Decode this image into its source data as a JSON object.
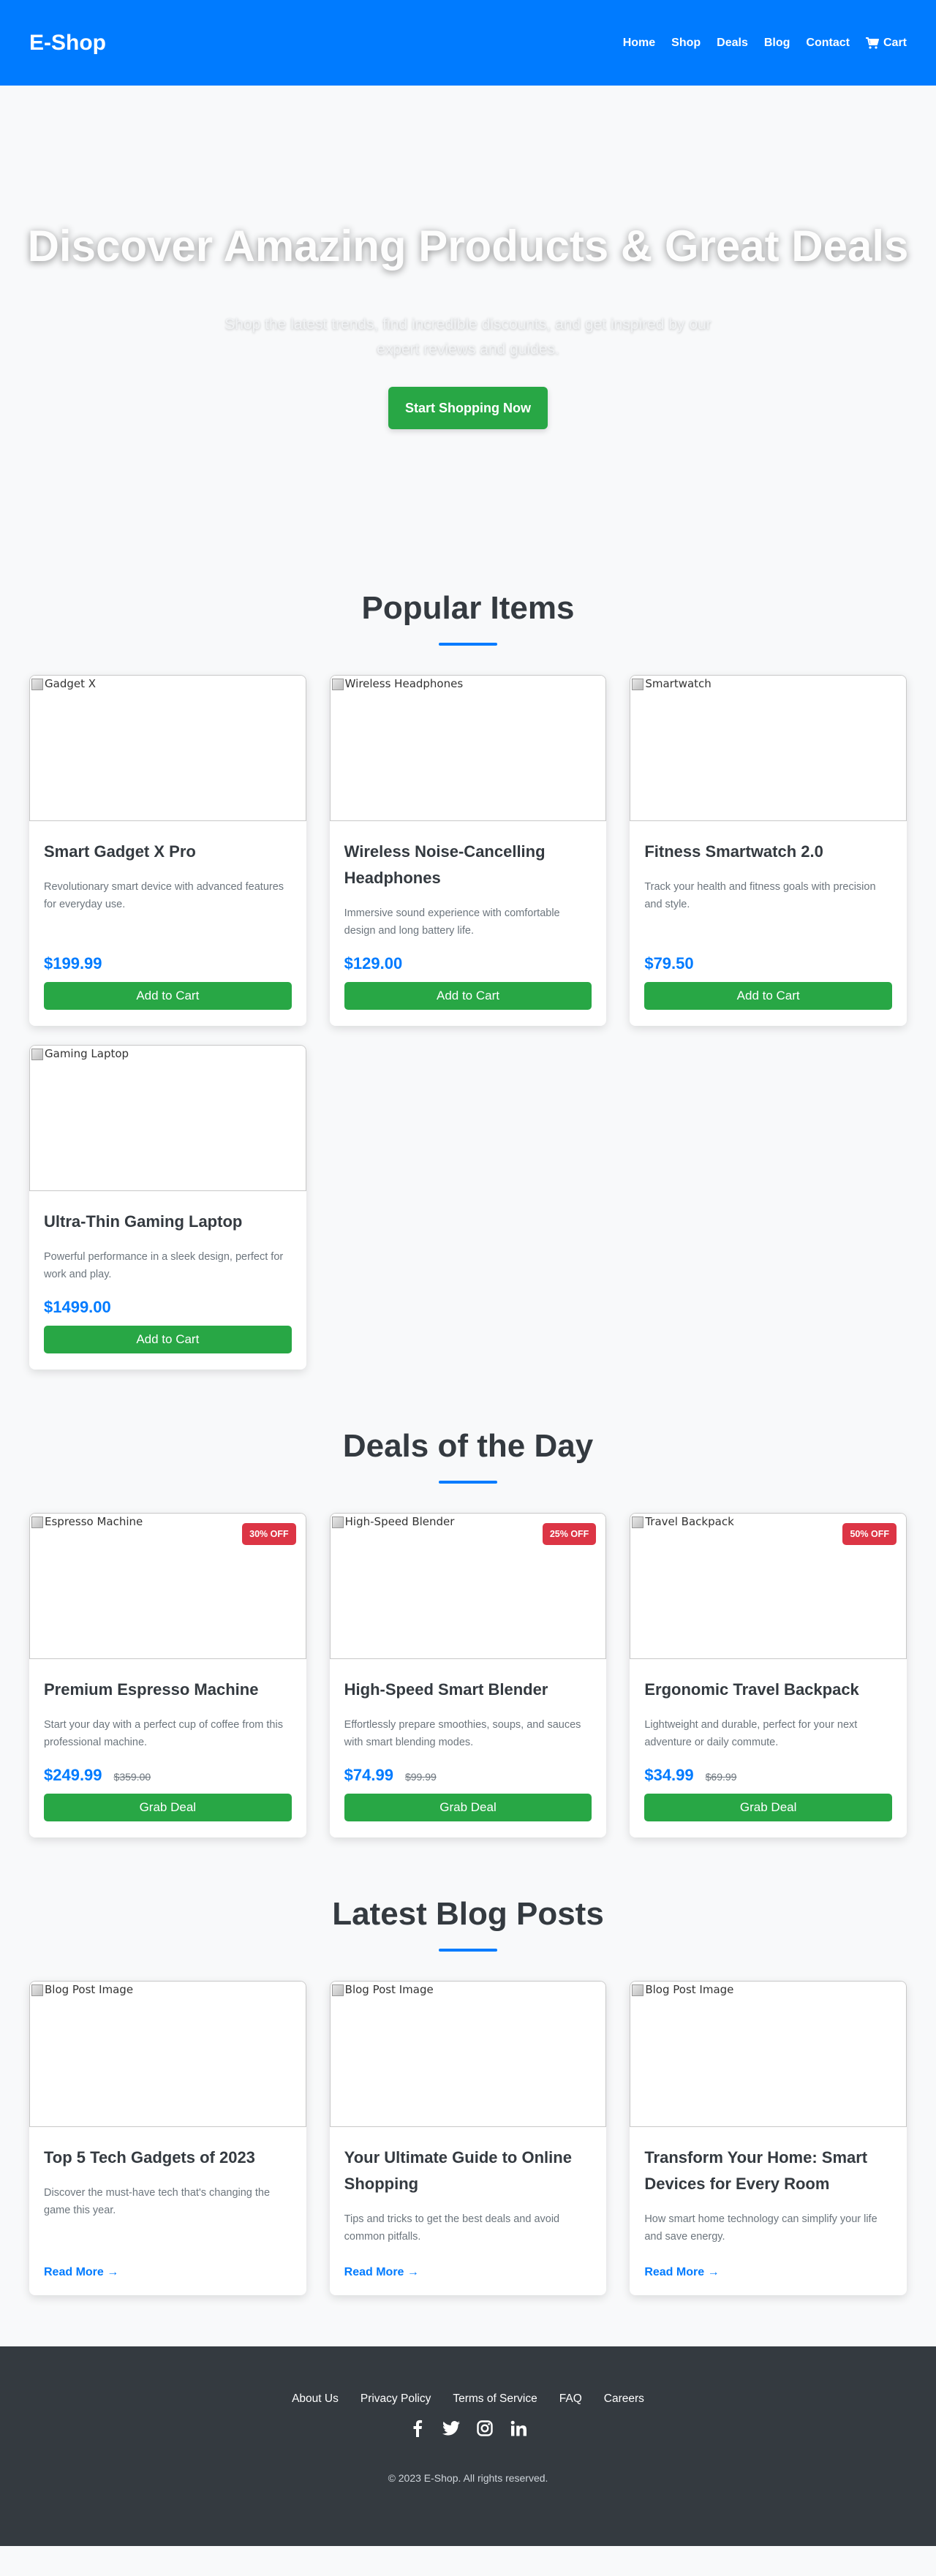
{
  "header": {
    "logo": "E-Shop",
    "nav": [
      "Home",
      "Shop",
      "Deals",
      "Blog",
      "Contact"
    ],
    "cart_label": "Cart"
  },
  "hero": {
    "title": "Discover Amazing Products & Great Deals",
    "subtitle": "Shop the latest trends, find incredible discounts, and get inspired by our expert reviews and guides.",
    "cta": "Start Shopping Now"
  },
  "popular": {
    "title": "Popular Items",
    "button_label": "Add to Cart",
    "items": [
      {
        "img_alt": "Gadget X",
        "title": "Smart Gadget X Pro",
        "desc": "Revolutionary smart device with advanced features for everyday use.",
        "price": "$199.99"
      },
      {
        "img_alt": "Wireless Headphones",
        "title": "Wireless Noise-Cancelling Headphones",
        "desc": "Immersive sound experience with comfortable design and long battery life.",
        "price": "$129.00"
      },
      {
        "img_alt": "Smartwatch",
        "title": "Fitness Smartwatch 2.0",
        "desc": "Track your health and fitness goals with precision and style.",
        "price": "$79.50"
      },
      {
        "img_alt": "Gaming Laptop",
        "title": "Ultra-Thin Gaming Laptop",
        "desc": "Powerful performance in a sleek design, perfect for work and play.",
        "price": "$1499.00"
      }
    ]
  },
  "deals": {
    "title": "Deals of the Day",
    "button_label": "Grab Deal",
    "items": [
      {
        "img_alt": "Espresso Machine",
        "badge": "30% OFF",
        "title": "Premium Espresso Machine",
        "desc": "Start your day with a perfect cup of coffee from this professional machine.",
        "price": "$249.99",
        "old_price": "$359.00"
      },
      {
        "img_alt": "High-Speed Blender",
        "badge": "25% OFF",
        "title": "High-Speed Smart Blender",
        "desc": "Effortlessly prepare smoothies, soups, and sauces with smart blending modes.",
        "price": "$74.99",
        "old_price": "$99.99"
      },
      {
        "img_alt": "Travel Backpack",
        "badge": "50% OFF",
        "title": "Ergonomic Travel Backpack",
        "desc": "Lightweight and durable, perfect for your next adventure or daily commute.",
        "price": "$34.99",
        "old_price": "$69.99"
      }
    ]
  },
  "blog": {
    "title": "Latest Blog Posts",
    "read_more": "Read More →",
    "posts": [
      {
        "img_alt": "Blog Post Image",
        "title": "Top 5 Tech Gadgets of 2023",
        "desc": "Discover the must-have tech that's changing the game this year."
      },
      {
        "img_alt": "Blog Post Image",
        "title": "Your Ultimate Guide to Online Shopping",
        "desc": "Tips and tricks to get the best deals and avoid common pitfalls."
      },
      {
        "img_alt": "Blog Post Image",
        "title": "Transform Your Home: Smart Devices for Every Room",
        "desc": "How smart home technology can simplify your life and save energy."
      }
    ]
  },
  "footer": {
    "links": [
      "About Us",
      "Privacy Policy",
      "Terms of Service",
      "FAQ",
      "Careers"
    ],
    "socials": [
      "facebook-icon",
      "twitter-icon",
      "instagram-icon",
      "linkedin-icon"
    ],
    "copyright": "© 2023 E-Shop. All rights reserved."
  },
  "colors": {
    "primary": "#007bff",
    "success": "#28a745",
    "danger": "#dc3545",
    "dark": "#343a40"
  }
}
